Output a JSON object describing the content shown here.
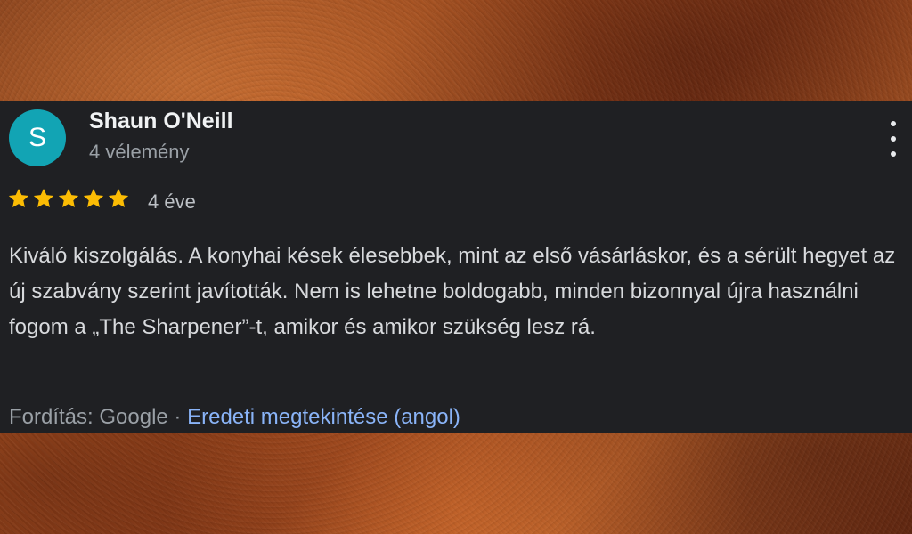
{
  "review": {
    "avatar_letter": "S",
    "avatar_color": "#12a4b4",
    "reviewer_name": "Shaun O'Neill",
    "review_count": "4 vélemény",
    "rating": 5,
    "rating_max": 5,
    "star_color": "#fbbc04",
    "age": "4 éve",
    "text": "Kiváló kiszolgálás. A konyhai kések élesebbek, mint az első vásárláskor, és a sérült hegyet az új szabvány szerint javították. Nem is lehetne boldogabb, minden bizonnyal újra használni fogom a „The Sharpener”-t, amikor és amikor szükség lesz rá.",
    "translated_by": "Fordítás: Google",
    "separator": " · ",
    "view_original": "Eredeti megtekintése (angol)",
    "menu_icon": "more-vert-icon"
  }
}
